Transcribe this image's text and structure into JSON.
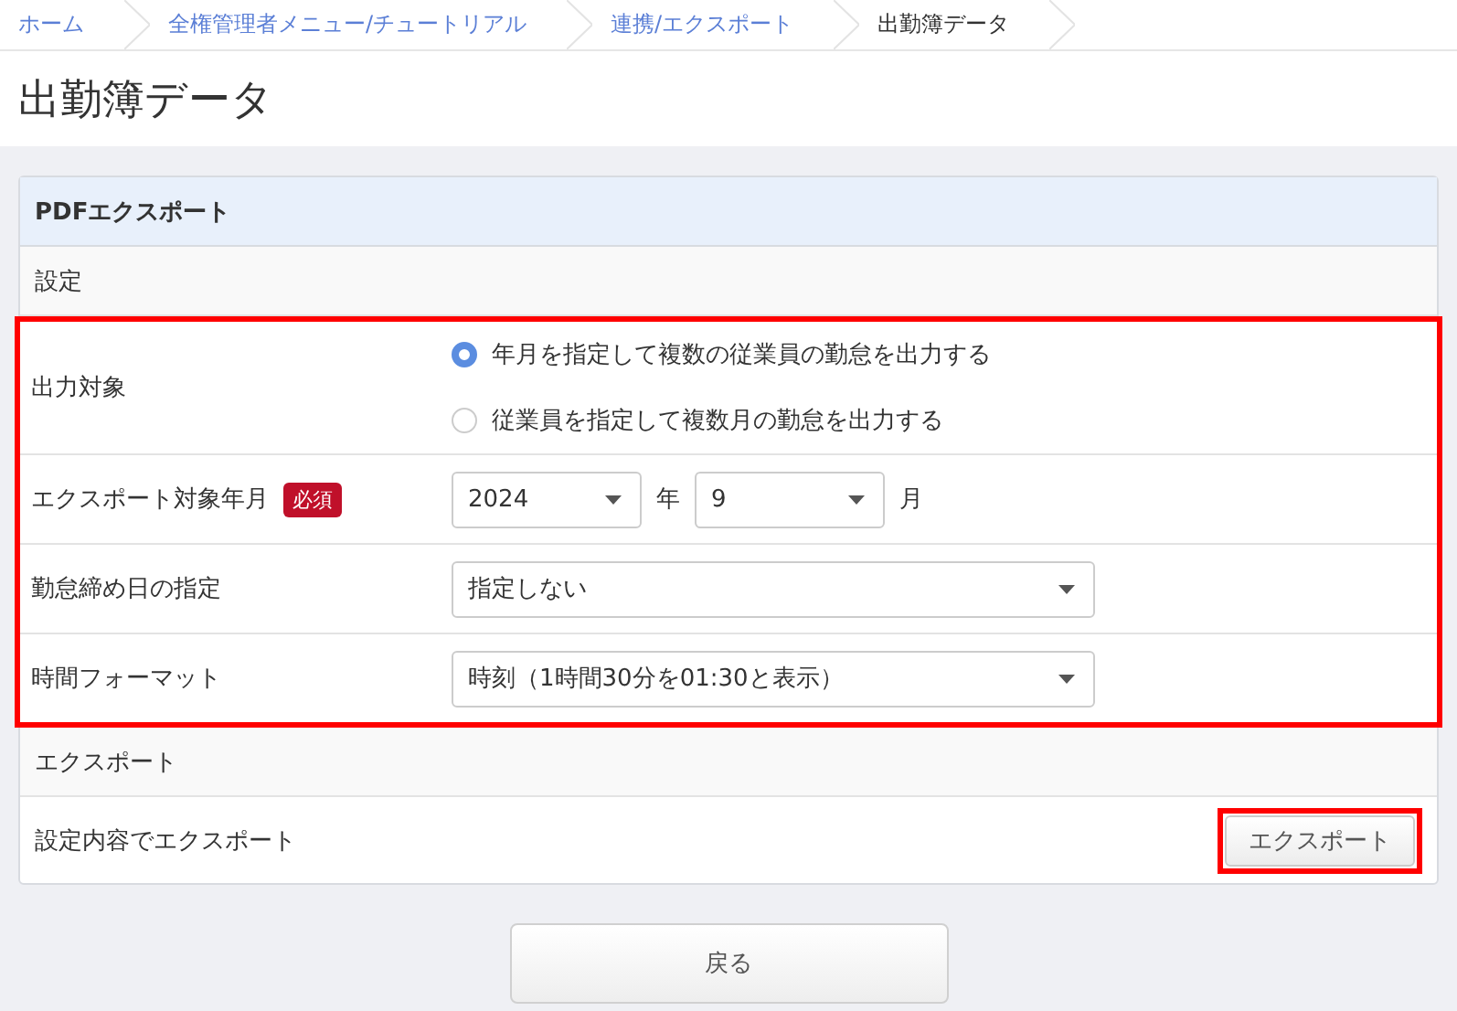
{
  "breadcrumb": [
    {
      "label": "ホーム",
      "current": false
    },
    {
      "label": "全権管理者メニュー/チュートリアル",
      "current": false
    },
    {
      "label": "連携/エクスポート",
      "current": false
    },
    {
      "label": "出勤簿データ",
      "current": true
    }
  ],
  "page_title": "出勤簿データ",
  "panel": {
    "title": "PDFエクスポート",
    "settings": {
      "heading": "設定",
      "highlighted": true,
      "rows": [
        {
          "kind": "radio",
          "label": "出力対象",
          "options": [
            {
              "label": "年月を指定して複数の従業員の勤怠を出力する",
              "selected": true
            },
            {
              "label": "従業員を指定して複数月の勤怠を出力する",
              "selected": false
            }
          ]
        },
        {
          "kind": "yearmonth",
          "label": "エクスポート対象年月",
          "badge": "必須",
          "year": "2024",
          "year_unit": "年",
          "month": "9",
          "month_unit": "月"
        },
        {
          "kind": "select",
          "label": "勤怠締め日の指定",
          "value": "指定しない"
        },
        {
          "kind": "select",
          "label": "時間フォーマット",
          "value": "時刻（1時間30分を01:30と表示）"
        }
      ]
    },
    "export": {
      "heading": "エクスポート",
      "label": "設定内容でエクスポート",
      "button": "エクスポート",
      "highlighted": true
    }
  },
  "back_button": "戻る"
}
